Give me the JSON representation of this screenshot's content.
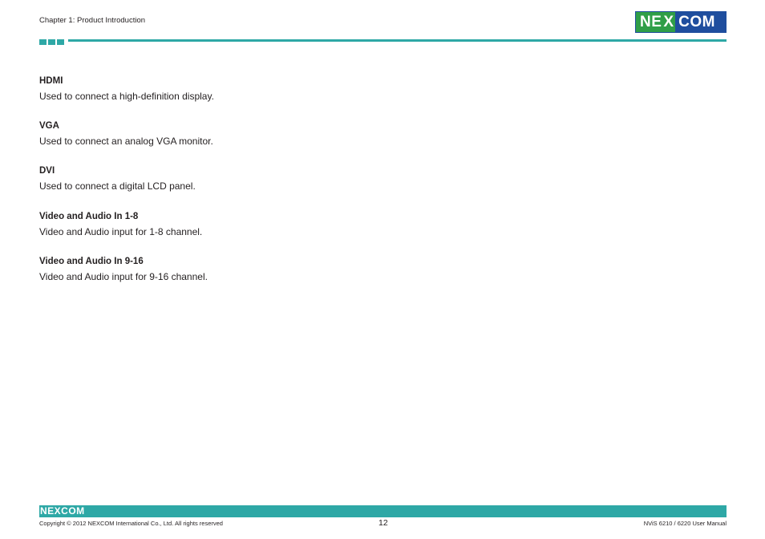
{
  "header": {
    "chapter": "Chapter 1: Product Introduction",
    "logo": {
      "part1": "NE",
      "part2": "X",
      "part3": "COM"
    }
  },
  "sections": [
    {
      "heading": "HDMI",
      "text": "Used to connect a high-definition display."
    },
    {
      "heading": "VGA",
      "text": "Used to connect an analog VGA monitor."
    },
    {
      "heading": "DVI",
      "text": "Used to connect a digital LCD panel."
    },
    {
      "heading": "Video and Audio In 1-8",
      "text": "Video and Audio input for 1-8 channel."
    },
    {
      "heading": "Video and Audio In 9-16",
      "text": "Video and Audio input for 9-16 channel."
    }
  ],
  "footer": {
    "logo": "NEXCOM",
    "copyright": "Copyright © 2012 NEXCOM International Co., Ltd. All rights reserved",
    "page_number": "12",
    "manual": "NViS 6210 / 6220 User Manual"
  },
  "colors": {
    "accent": "#2ea8a6",
    "logo_green": "#2f9e48",
    "logo_blue": "#1f4e9e"
  }
}
